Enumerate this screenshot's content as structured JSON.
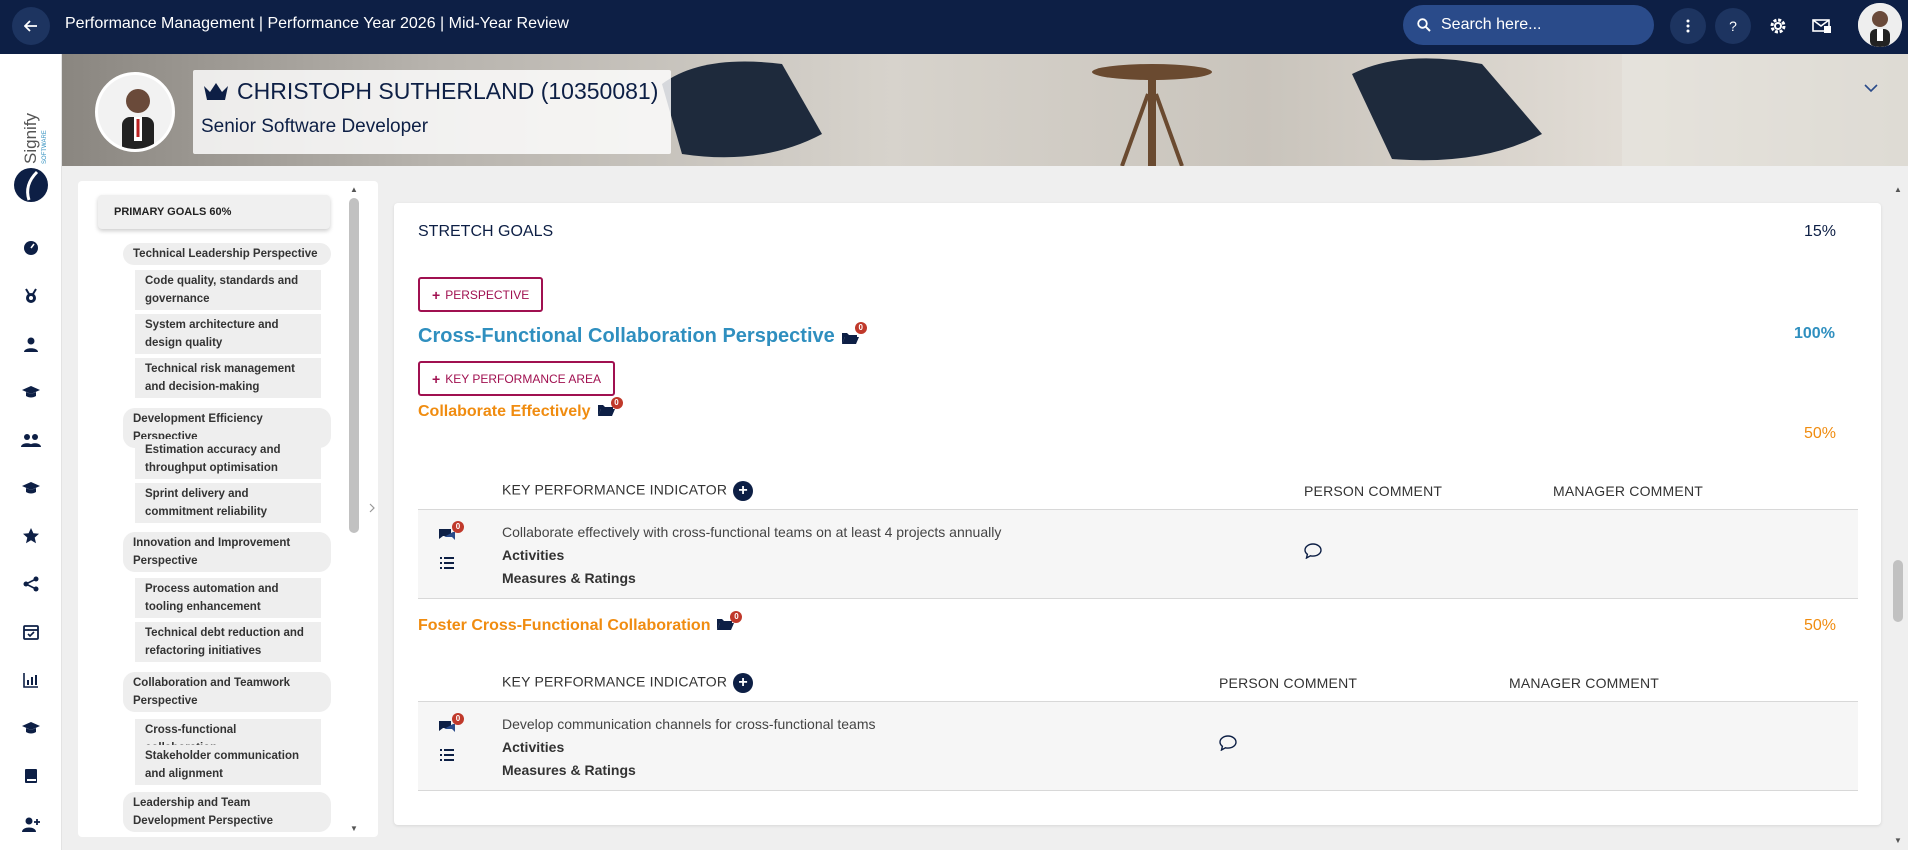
{
  "header": {
    "title": "Performance Management | Performance Year 2026 | Mid-Year Review",
    "search_placeholder": "Search here...",
    "help_label": "?"
  },
  "brand": {
    "logo_text": "Signify",
    "logo_sub": "SOFTWARE"
  },
  "profile": {
    "name": "CHRISTOPH SUTHERLAND (10350081)",
    "role": "Senior Software Developer"
  },
  "outline": {
    "header": "PRIMARY GOALS 60%",
    "items": [
      {
        "type": "perspective",
        "label": "Technical Leadership Perspective"
      },
      {
        "type": "kpa",
        "label": "Code quality, standards and governance"
      },
      {
        "type": "kpa",
        "label": "System architecture and design quality"
      },
      {
        "type": "kpa",
        "label": "Technical risk management and decision-making"
      },
      {
        "type": "perspective",
        "label": "Development Efficiency Perspective"
      },
      {
        "type": "kpa",
        "label": "Estimation accuracy and throughput optimisation"
      },
      {
        "type": "kpa",
        "label": "Sprint delivery and commitment reliability"
      },
      {
        "type": "perspective",
        "label": "Innovation and Improvement Perspective"
      },
      {
        "type": "kpa",
        "label": "Process automation and tooling enhancement"
      },
      {
        "type": "kpa",
        "label": "Technical debt reduction and refactoring initiatives"
      },
      {
        "type": "perspective",
        "label": "Collaboration and Teamwork Perspective"
      },
      {
        "type": "kpa",
        "label": "Cross-functional collaboration"
      },
      {
        "type": "kpa",
        "label": "Stakeholder communication and alignment"
      },
      {
        "type": "perspective",
        "label": "Leadership and Team Development Perspective"
      }
    ]
  },
  "main": {
    "section_title": "STRETCH GOALS",
    "section_pct": "15%",
    "add_perspective_label": "PERSPECTIVE",
    "perspective": {
      "title": "Cross-Functional Collaboration Perspective",
      "pct": "100%",
      "badge": "0"
    },
    "add_kpa_label": "KEY PERFORMANCE AREA",
    "kpas": [
      {
        "title": "Collaborate Effectively",
        "pct": "50%",
        "badge": "0",
        "col_kpi": "KEY PERFORMANCE INDICATOR",
        "col_person": "PERSON COMMENT",
        "col_manager": "MANAGER COMMENT",
        "kpi_badge": "0",
        "kpi_text": "Collaborate effectively with cross-functional teams on at least 4 projects annually",
        "activities": "Activities",
        "measures": "Measures & Ratings"
      },
      {
        "title": "Foster Cross-Functional Collaboration",
        "pct": "50%",
        "badge": "0",
        "col_kpi": "KEY PERFORMANCE INDICATOR",
        "col_person": "PERSON COMMENT",
        "col_manager": "MANAGER COMMENT",
        "kpi_badge": "0",
        "kpi_text": "Develop communication channels for cross-functional teams",
        "activities": "Activities",
        "measures": "Measures & Ratings"
      }
    ]
  },
  "colors": {
    "topbar": "#0d1f45",
    "accent_blue": "#2f8fbf",
    "accent_orange": "#f08c10",
    "button_border": "#a01050",
    "badge_red": "#c0392b"
  }
}
